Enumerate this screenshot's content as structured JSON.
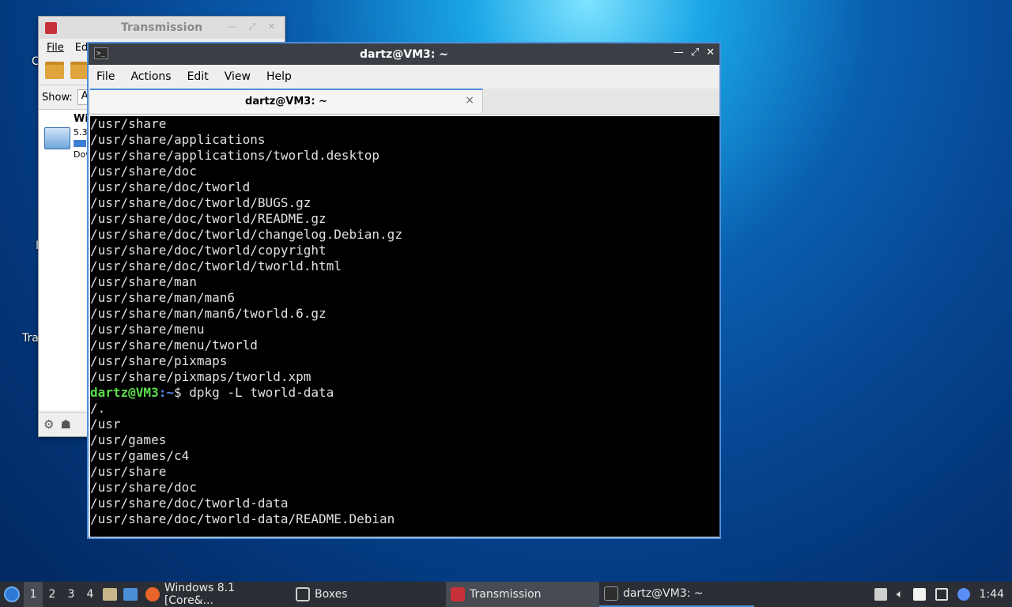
{
  "desktop": {
    "icon_labels": [
      "C",
      "I",
      "Tra"
    ]
  },
  "transmission": {
    "title": "Transmission",
    "menu": [
      "File",
      "Ed"
    ],
    "show_label": "Show:",
    "show_value": "A",
    "torrent": {
      "name": "Wi",
      "size": "5.3",
      "status": "Dov"
    }
  },
  "terminal": {
    "title": "dartz@VM3: ~",
    "menu": [
      "File",
      "Actions",
      "Edit",
      "View",
      "Help"
    ],
    "tab_title": "dartz@VM3: ~",
    "tab_close": "×",
    "lines_before": [
      "/usr/share",
      "/usr/share/applications",
      "/usr/share/applications/tworld.desktop",
      "/usr/share/doc",
      "/usr/share/doc/tworld",
      "/usr/share/doc/tworld/BUGS.gz",
      "/usr/share/doc/tworld/README.gz",
      "/usr/share/doc/tworld/changelog.Debian.gz",
      "/usr/share/doc/tworld/copyright",
      "/usr/share/doc/tworld/tworld.html",
      "/usr/share/man",
      "/usr/share/man/man6",
      "/usr/share/man/man6/tworld.6.gz",
      "/usr/share/menu",
      "/usr/share/menu/tworld",
      "/usr/share/pixmaps",
      "/usr/share/pixmaps/tworld.xpm"
    ],
    "prompt": {
      "user": "dartz@VM3",
      "sep": ":",
      "path": "~",
      "symbol": "$ ",
      "command": "dpkg -L tworld-data"
    },
    "lines_after": [
      "/.",
      "/usr",
      "/usr/games",
      "/usr/games/c4",
      "/usr/share",
      "/usr/share/doc",
      "/usr/share/doc/tworld-data",
      "/usr/share/doc/tworld-data/README.Debian"
    ]
  },
  "taskbar": {
    "workspaces": [
      "1",
      "2",
      "3",
      "4"
    ],
    "active_workspace": "1",
    "tasks": [
      {
        "label": "Windows 8.1 [Core&...",
        "icon": "firefox-icon",
        "color": "#e8662a"
      },
      {
        "label": "Boxes",
        "icon": "boxes-icon",
        "color": "#cfcfcf"
      },
      {
        "label": "Transmission",
        "icon": "transmission-icon",
        "color": "#c8303a"
      },
      {
        "label": "dartz@VM3: ~",
        "icon": "terminal-icon",
        "color": "#2e2e2e"
      }
    ],
    "clock": "1:44"
  }
}
